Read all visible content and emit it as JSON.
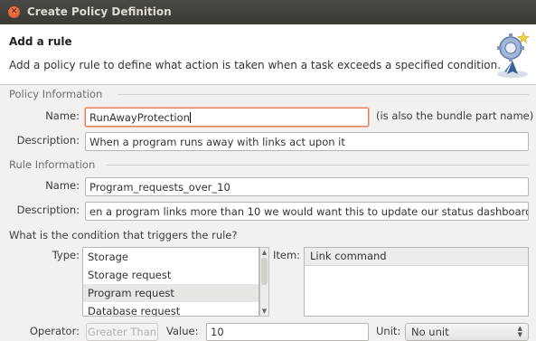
{
  "window": {
    "title": "Create Policy Definition",
    "close_icon": "close-icon"
  },
  "header": {
    "title": "Add a rule",
    "description": "Add a policy rule to define what action is taken when a task exceeds a specified condition.",
    "icon": "gear-badge-icon"
  },
  "policy_info": {
    "group_label": "Policy Information",
    "name_label": "Name:",
    "name_value": "RunAwayProtection",
    "name_hint": "(is also the bundle part name)",
    "description_label": "Description:",
    "description_value": "When a program runs away with links act upon it"
  },
  "rule_info": {
    "group_label": "Rule Information",
    "name_label": "Name:",
    "name_value": "Program_requests_over_10",
    "description_label": "Description:",
    "description_value": "en a program links more than 10 we would want this to update our status dashboard",
    "condition_question": "What is the condition that triggers the rule?",
    "type_label": "Type:",
    "types": [
      "Storage",
      "Storage request",
      "Program request",
      "Database request"
    ],
    "selected_type": "Program request",
    "item_label": "Item:",
    "item_header": "Link command",
    "operator_label": "Operator:",
    "operator_button": "Greater Than",
    "value_label": "Value:",
    "value_value": "10",
    "unit_label": "Unit:",
    "unit_value": "No unit"
  },
  "colors": {
    "titlebar": "#3f3e3a",
    "focus_border": "#e0805a",
    "close_button": "#e0592a",
    "background": "#f2f1f0"
  }
}
